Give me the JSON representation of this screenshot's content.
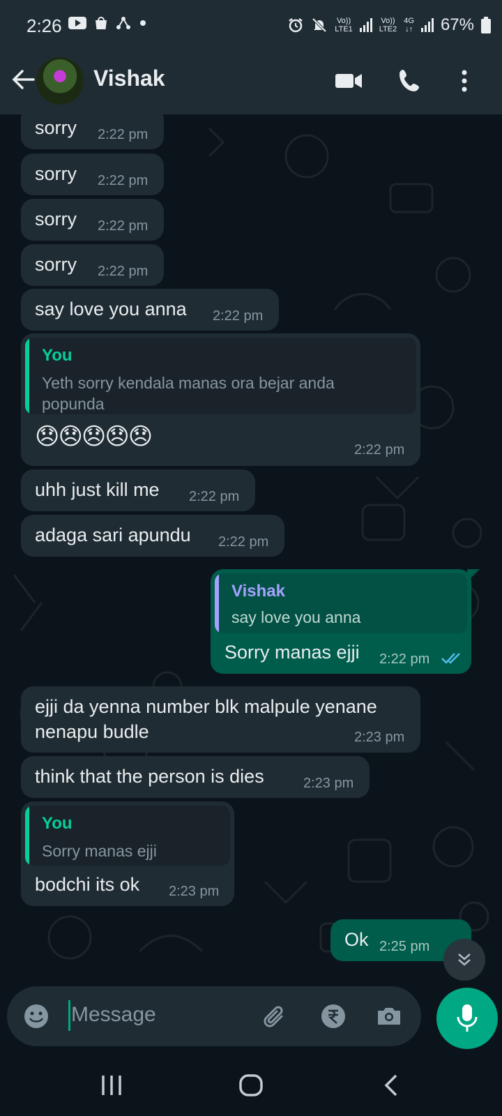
{
  "status_bar": {
    "time": "2:26",
    "battery": "67%",
    "sim1_top": "Vo))",
    "sim1_bottom": "LTE1",
    "sim2_top": "Vo))",
    "sim2_bottom": "LTE2",
    "net_type": "4G"
  },
  "header": {
    "contact_name": "Vishak"
  },
  "messages": [
    {
      "text": "sorry",
      "time": "2:22 pm"
    },
    {
      "text": "sorry",
      "time": "2:22 pm"
    },
    {
      "text": "sorry",
      "time": "2:22 pm"
    },
    {
      "text": "sorry",
      "time": "2:22 pm"
    },
    {
      "text": "say love you anna",
      "time": "2:22 pm"
    },
    {
      "quote_name": "You",
      "quote_line1": "Yeth sorry kendala manas ora bejar anda",
      "quote_line2": "popunda",
      "text": "😞😞😞😞😞",
      "time": "2:22 pm"
    },
    {
      "text": "uhh just kill me",
      "time": "2:22 pm"
    },
    {
      "text": "adaga sari apundu",
      "time": "2:22 pm"
    },
    {
      "quote_name": "Vishak",
      "quote_line1": "say love you anna",
      "text": "Sorry manas ejji",
      "time": "2:22 pm",
      "status": "read"
    },
    {
      "text_line1": "ejji da yenna number blk malpule yenane",
      "text_line2": "nenapu budle",
      "time": "2:23 pm"
    },
    {
      "text": "think that the person is dies",
      "time": "2:23 pm"
    },
    {
      "quote_name": "You",
      "quote_line1": "Sorry manas ejji",
      "text": "bodchi its ok",
      "time": "2:23 pm"
    },
    {
      "text": "Ok",
      "time": "2:25 pm"
    }
  ],
  "composer": {
    "placeholder": "Message"
  },
  "colors": {
    "incoming_bubble": "#202c33",
    "outgoing_bubble": "#005c4b",
    "accent": "#00a884",
    "quote_you": "#06cf9c",
    "quote_vishak": "#a5a2ff"
  }
}
